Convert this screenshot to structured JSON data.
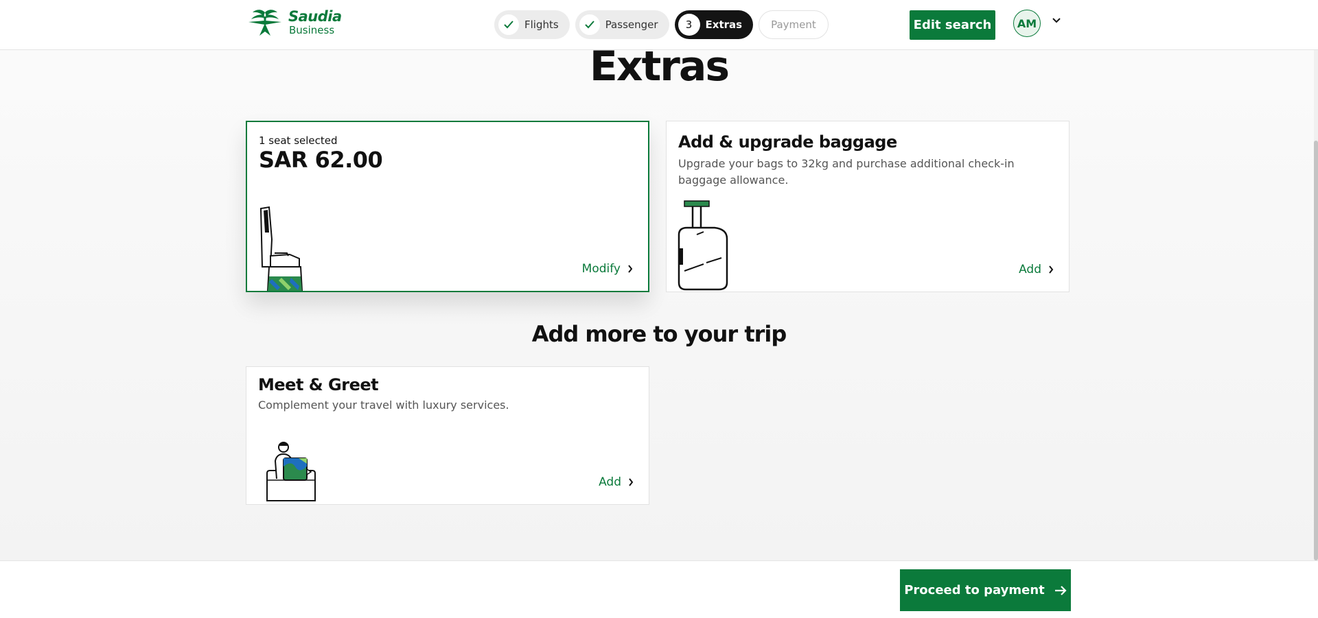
{
  "header": {
    "logo_brand": "Saudia",
    "logo_sub": "Business",
    "steps": [
      {
        "label": "Flights",
        "state": "done"
      },
      {
        "label": "Passenger",
        "state": "done"
      },
      {
        "label": "Extras",
        "number": "3",
        "state": "active"
      },
      {
        "label": "Payment",
        "state": "pending"
      }
    ],
    "edit_search_label": "Edit search",
    "avatar_initials": "AM"
  },
  "page": {
    "title": "Extras",
    "section_title": "Add more to your trip"
  },
  "cards": {
    "seat": {
      "eyebrow": "1 seat selected",
      "price": "SAR 62.00",
      "action": "Modify"
    },
    "baggage": {
      "title": "Add & upgrade baggage",
      "description": "Upgrade your bags to 32kg and purchase additional check-in baggage allowance.",
      "action": "Add"
    },
    "meet_greet": {
      "title": "Meet & Greet",
      "description": "Complement your travel with luxury services.",
      "action": "Add"
    }
  },
  "footer": {
    "proceed_label": "Proceed to payment"
  },
  "colors": {
    "brand_green": "#0b7a3b",
    "dark_pill": "#141414"
  },
  "icons": [
    "saudia-palm-logo-icon",
    "check-icon",
    "chevron-down-icon",
    "chevron-right-icon",
    "arrow-right-icon",
    "seat-illustration-icon",
    "suitcase-illustration-icon",
    "meet-greet-illustration-icon"
  ]
}
